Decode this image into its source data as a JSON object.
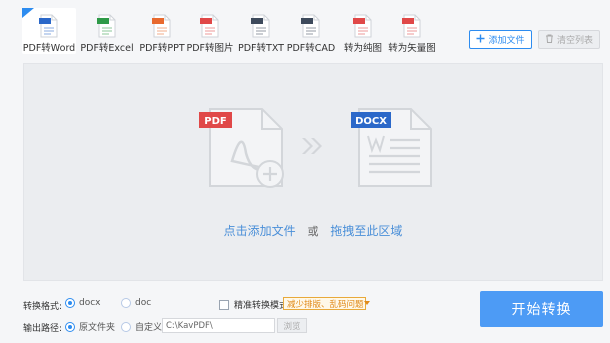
{
  "tabs": [
    {
      "label": "PDF转Word",
      "icon": "word-file-icon",
      "tag": "DOC",
      "color": "#2b68c9",
      "active": true
    },
    {
      "label": "PDF转Excel",
      "icon": "excel-file-icon",
      "tag": "XLS",
      "color": "#2e9a48"
    },
    {
      "label": "PDF转PPT",
      "icon": "ppt-file-icon",
      "tag": "PPT",
      "color": "#e8692e"
    },
    {
      "label": "PDF转图片",
      "icon": "image-file-icon",
      "tag": "JPG",
      "color": "#e04848"
    },
    {
      "label": "PDF转TXT",
      "icon": "txt-file-icon",
      "tag": "TXT",
      "color": "#3e4a5c"
    },
    {
      "label": "PDF转CAD",
      "icon": "cad-file-icon",
      "tag": "DWG",
      "color": "#3e4a5c"
    },
    {
      "label": "转为纯图",
      "icon": "pure-image-file-icon",
      "tag": "PDF",
      "color": "#e04848"
    },
    {
      "label": "转为矢量图",
      "icon": "vector-file-icon",
      "tag": "PDF",
      "color": "#e04848"
    }
  ],
  "toolbar": {
    "add_label": "添加文件",
    "clear_label": "清空列表"
  },
  "drop": {
    "from_tag": "PDF",
    "to_tag": "DOCX",
    "click_add": "点击添加文件",
    "or": "或",
    "drag_here": "拖拽至此区域"
  },
  "settings": {
    "format_label": "转换格式:",
    "format_docx": "docx",
    "format_doc": "doc",
    "precise_label": "精准转换模式",
    "precise_option": "减少排版、乱码问题",
    "output_label": "输出路径:",
    "output_original": "原文件夹",
    "output_custom": "自定义",
    "path_value": "C:\\KavPDF\\",
    "browse_label": "浏览"
  },
  "start_label": "开始转换",
  "colors": {
    "accent": "#2d8cf0",
    "pdf_red": "#e04848",
    "docx_blue": "#2b68c9",
    "warning": "#e08a1a"
  }
}
